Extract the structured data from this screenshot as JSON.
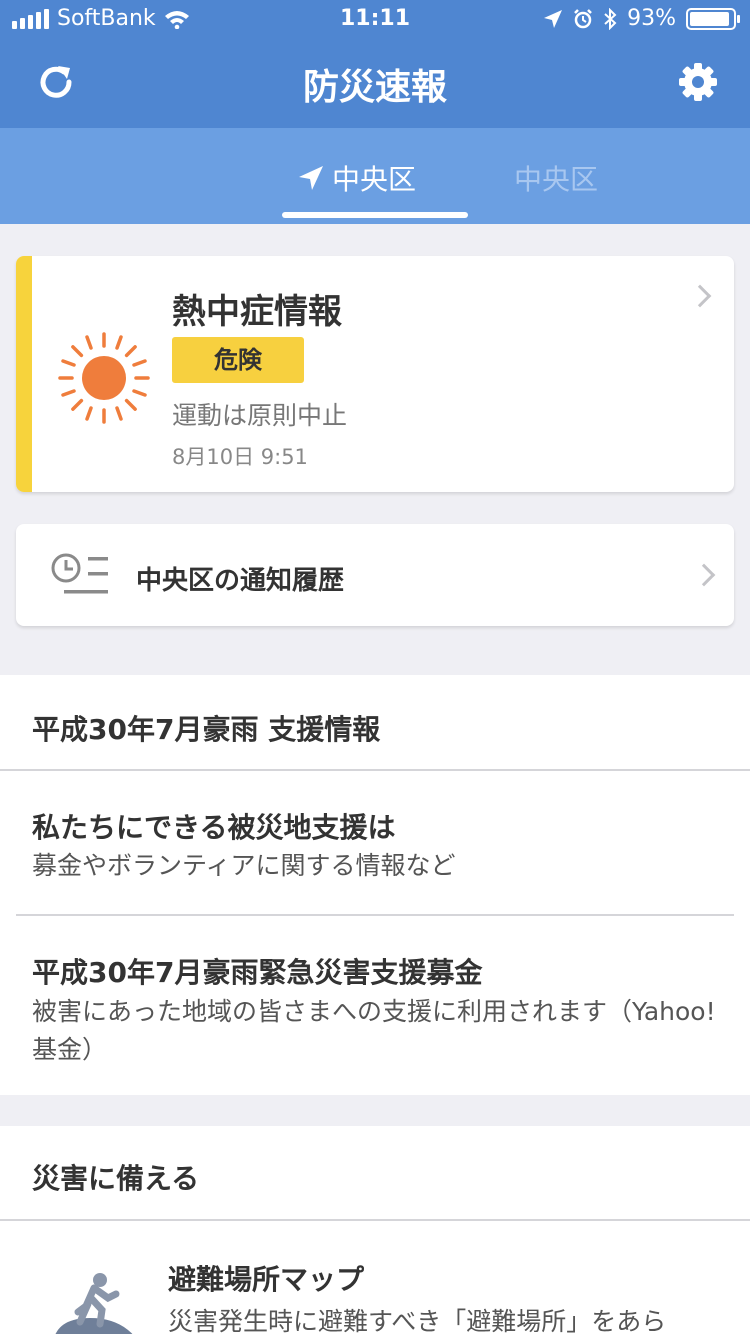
{
  "status_bar": {
    "carrier": "SoftBank",
    "time": "11:11",
    "battery": "93%",
    "battery_level": 0.93
  },
  "header": {
    "title": "防災速報",
    "refresh_icon": "refresh-icon",
    "settings_icon": "gear-icon",
    "bg_color": "#4f86d1"
  },
  "tabs": [
    {
      "label": "中央区",
      "icon": "location-arrow-icon",
      "active": true
    },
    {
      "label": "中央区",
      "active": false
    }
  ],
  "heat_card": {
    "title": "熱中症情報",
    "level": "危険",
    "description": "運動は原則中止",
    "timestamp": "8月10日 9:51",
    "icon": "sun-icon",
    "accent_color": "#f7d33c"
  },
  "history_card": {
    "title": "中央区の通知履歴",
    "icon": "clock-list-icon"
  },
  "support_section": {
    "heading": "平成30年7月豪雨 支援情報",
    "items": [
      {
        "title": "私たちにできる被災地支援は",
        "description": "募金やボランティアに関する情報など"
      },
      {
        "title": "平成30年7月豪雨緊急災害支援募金",
        "description": "被害にあった地域の皆さまへの支援に利用されます（Yahoo!基金）"
      }
    ]
  },
  "prepare_section": {
    "heading": "災害に備える",
    "items": [
      {
        "title": "避難場所マップ",
        "description": "災害発生時に避難すべき「避難場所」をあら",
        "icon": "evacuation-person-icon"
      }
    ]
  }
}
